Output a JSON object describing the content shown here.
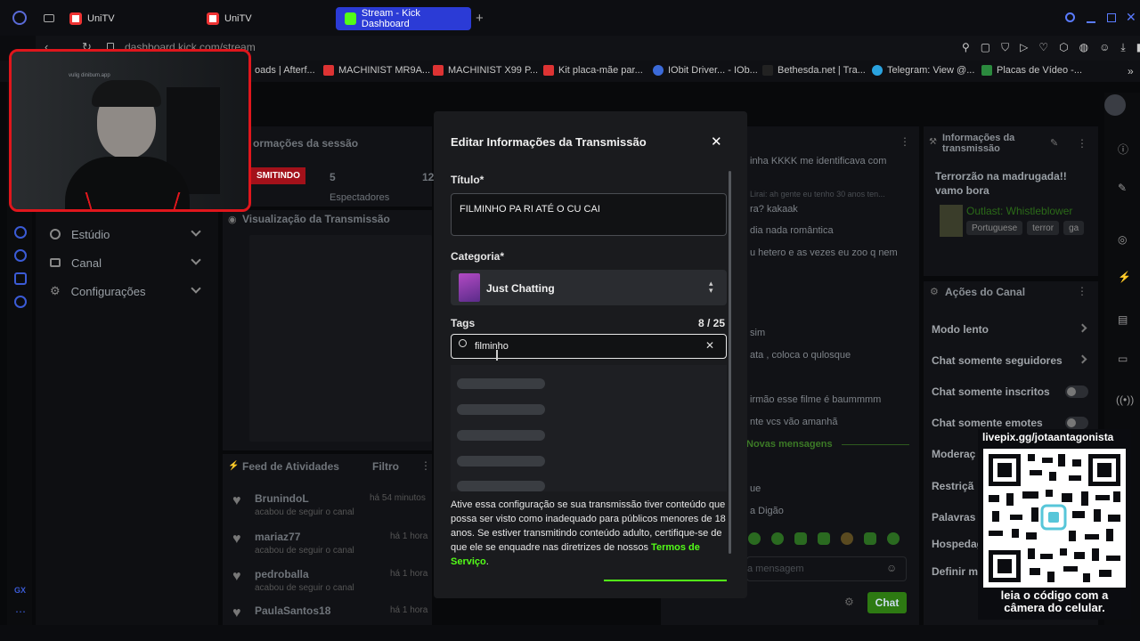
{
  "browser": {
    "tabs": [
      {
        "label": "UniTV"
      },
      {
        "label": "UniTV"
      },
      {
        "label": "Stream - Kick Dashboard"
      }
    ],
    "address": "dashboard.kick.com/stream",
    "bookmarks": [
      "oads | Afterf...",
      "MACHINIST MR9A...",
      "MACHINIST X99 P...",
      "Kit placa-mãe par...",
      "IObit Driver... - IOb...",
      "Bethesda.net | Tra...",
      "Telegram: View @...",
      "Placas de Vídeo -..."
    ]
  },
  "webcam": {
    "overlay_text": "vulig dinibum.app"
  },
  "sidebar": {
    "items": [
      {
        "label": "Estúdio"
      },
      {
        "label": "Canal"
      },
      {
        "label": "Configurações"
      }
    ]
  },
  "session": {
    "title": "ormações da sessão",
    "live_badge": "SMITINDO",
    "viewers_count": "5",
    "viewers_label": "Espectadores",
    "other_count": "12"
  },
  "preview": {
    "title": "Visualização da Transmissão"
  },
  "feed": {
    "title": "Feed de Atividades",
    "filter": "Filtro",
    "rows": [
      {
        "name": "BrunindoL",
        "time": "há 54 minutos",
        "action": "acabou de seguir o canal"
      },
      {
        "name": "mariaz77",
        "time": "há 1 hora",
        "action": "acabou de seguir o canal"
      },
      {
        "name": "pedroballa",
        "time": "há 1 hora",
        "action": "acabou de seguir o canal"
      },
      {
        "name": "PaulaSantos18",
        "time": "há 1 hora",
        "action": ""
      }
    ]
  },
  "chat": {
    "lines": [
      "inha KKKK me identificava com",
      "Lirai: ah gente eu tenho 30 anos ten...",
      "ra? kakaak",
      "dia nada romântica",
      "u hetero e as vezes eu zoo q nem",
      "sim",
      "ata , coloca o qulosque",
      "irmão esse filme é baummmm",
      "nte vcs vão amanhã"
    ],
    "new_messages": "Novas mensagens",
    "lower_lines": [
      "ue",
      "a Digão"
    ],
    "input_placeholder": "a mensagem",
    "send": "Chat"
  },
  "stream_info": {
    "title": "Informações da transmissão",
    "stream_title": "Terrorzão na madrugada!! vamo bora",
    "game": "Outlast: Whistleblower",
    "tags": [
      "Portuguese",
      "terror",
      "ga"
    ]
  },
  "channel_actions": {
    "title": "Ações do Canal",
    "items": [
      {
        "label": "Modo lento"
      },
      {
        "label": "Chat somente seguidores"
      },
      {
        "label": "Chat somente inscritos"
      },
      {
        "label": "Chat somente emotes"
      },
      {
        "label": "Moderaç"
      },
      {
        "label": "Restriçã"
      },
      {
        "label": "Palavras"
      },
      {
        "label": "Hospedag"
      },
      {
        "label": "Definir m"
      }
    ]
  },
  "modal": {
    "title": "Editar Informações da Transmissão",
    "title_label": "Título*",
    "title_value": "FILMINHO PA RI ATÉ O CU CAI",
    "category_label": "Categoria*",
    "category_value": "Just Chatting",
    "tags_label": "Tags",
    "tags_count": "8 / 25",
    "tag_search_value": "filminho",
    "disclaimer_line1": "Ative essa configuração se sua transmissão tiver conteúdo",
    "disclaimer_body": "que possa ser visto como inadequado para públicos menores de 18 anos. Se estiver transmitindo conteúdo adulto, certifique-se de que ele se enquadre nas diretrizes de nossos",
    "terms_link": "Termos de Serviço",
    "terms_end": "."
  },
  "qr": {
    "url": "livepix.gg/jotaantagonista",
    "caption": "leia o código com a câmera do celular."
  },
  "colors": {
    "kick_green": "#53fc18",
    "accent_blue": "#2b3bd6",
    "webcam_red": "#e0161c"
  }
}
